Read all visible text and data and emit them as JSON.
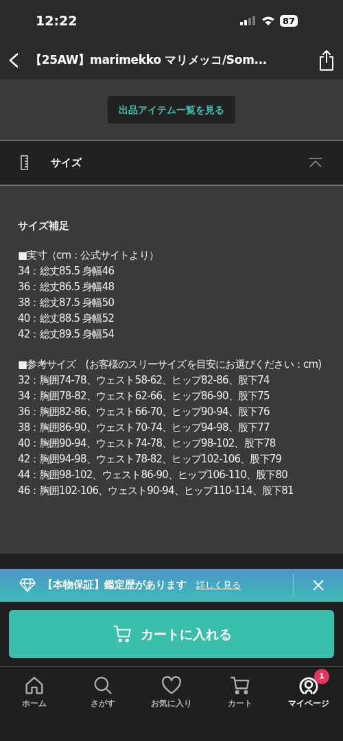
{
  "status_bar": {
    "time": "12:22",
    "battery": "87"
  },
  "nav": {
    "title": "【25AW】marimekko マリメッコ/Som..."
  },
  "shop_button": "出品アイテム一覧を見る",
  "size_section": {
    "title": "サイズ",
    "expanded": true,
    "heading": "サイズ補足",
    "paragraphs": [
      [
        "■実寸（cm：公式サイトより）",
        "34：総丈85.5 身幅46",
        "36：総丈86.5 身幅48",
        "38：総丈87.5 身幅50",
        "40：総丈88.5 身幅52",
        "42：総丈89.5 身幅54"
      ],
      [
        "■参考サイズ　(お客様のスリーサイズを目安にお選びください：cm)",
        "32：胸囲74-78、ウェスト58-62、ヒップ82-86、股下74",
        "34：胸囲78-82、ウェスト62-66、ヒップ86-90、股下75",
        "36：胸囲82-86、ウェスト66-70、ヒップ90-94、股下76",
        "38：胸囲86-90、ウェスト70-74、ヒップ94-98、股下77",
        "40：胸囲90-94、ウェスト74-78、ヒップ98-102、股下78",
        "42：胸囲94-98、ウェスト78-82、ヒップ102-106、股下79",
        "44：胸囲98-102、ウェスト86-90、ヒップ106-110、股下80",
        "46：胸囲102-106、ウェスト90-94、ヒップ110-114、股下81"
      ]
    ]
  },
  "banner": {
    "text": "【本物保証】鑑定歴があります",
    "link": "詳しく見る"
  },
  "cart_button": "カートに入れる",
  "tab_bar": [
    {
      "kind": "home",
      "label": "ホーム",
      "selected": false
    },
    {
      "kind": "search",
      "label": "さがす",
      "selected": false
    },
    {
      "kind": "heart",
      "label": "お気に入り",
      "selected": false
    },
    {
      "kind": "cart",
      "label": "カート",
      "selected": false
    },
    {
      "kind": "user",
      "label": "マイページ",
      "selected": true,
      "badge": "1"
    }
  ]
}
